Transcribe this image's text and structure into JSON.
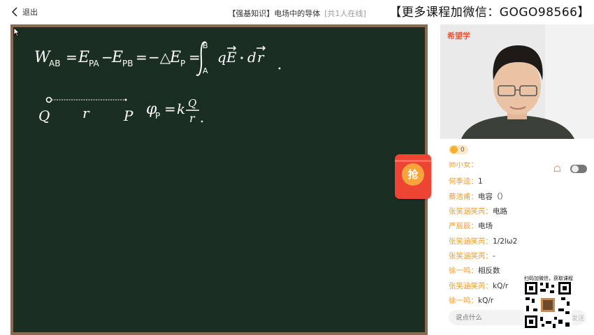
{
  "header": {
    "back_label": "退出",
    "title": "【强基知识】电场中的导体",
    "online": "[共1人在线]",
    "watermark": "【更多课程加微信：GOGO98566】"
  },
  "board": {
    "formula_top": "W_AB = E_pA − E_pB = −ΔE_p = ∫_A^B qE · dr",
    "labels": {
      "q": "Q",
      "r": "r",
      "p": "P"
    },
    "formula_potential": "φ_p = k Q/r"
  },
  "grab_button": {
    "label": "抢"
  },
  "video": {
    "brand": "希望学"
  },
  "chat": {
    "likes": "0",
    "partial": "师小女：",
    "messages": [
      {
        "name": "何季逵",
        "text": "1"
      },
      {
        "name": "蔡浩甫",
        "text": "电容（）"
      },
      {
        "name": "张笑涵笑芮",
        "text": "电路"
      },
      {
        "name": "严辰辰",
        "text": "电场"
      },
      {
        "name": "张笑涵笑芮",
        "text": "1/2lω2"
      },
      {
        "name": "张笑涵笑芮",
        "text": "-"
      },
      {
        "name": "徐一鸣",
        "text": "相反数"
      },
      {
        "name": "张笑涵笑芮",
        "text": "kQ/r"
      },
      {
        "name": "徐一鸣",
        "text": "kQ/r"
      }
    ],
    "toggle_label": "问",
    "input_placeholder": "说点什么",
    "send_label": "发送"
  },
  "qr": {
    "caption": "扫码加微信，获取课程"
  },
  "colors": {
    "board": "#1b2e22",
    "frame": "#8b6a4f",
    "accent": "#ee4434",
    "username": "#f39c2b"
  }
}
